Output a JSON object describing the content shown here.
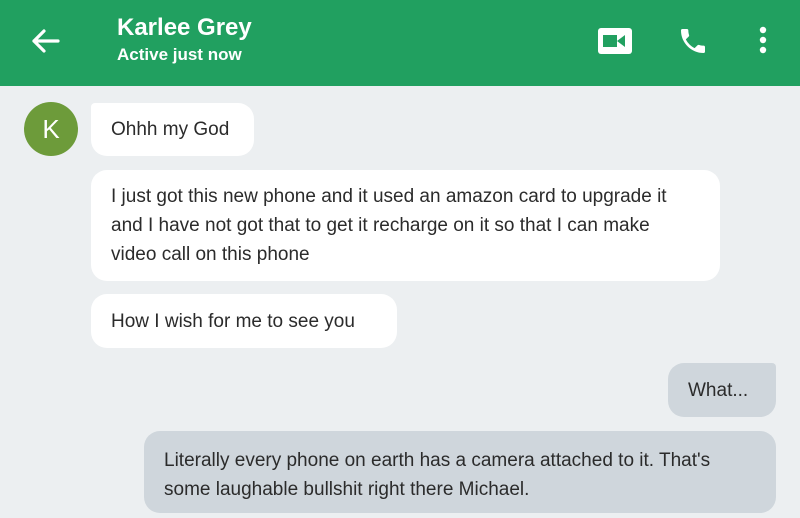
{
  "header": {
    "contact_name": "Karlee Grey",
    "status": "Active just now",
    "background_color": "#21a060",
    "icons": {
      "back": "arrow-left-icon",
      "video": "video-camera-icon",
      "call": "phone-icon",
      "menu": "more-vert-icon"
    }
  },
  "contact": {
    "avatar_initial": "K",
    "avatar_color": "#6d9b3a"
  },
  "messages": [
    {
      "sender": "incoming",
      "text": "Ohhh my God"
    },
    {
      "sender": "incoming",
      "text": "I just got this new phone and it used an amazon card to upgrade it and I have not got that to get it recharge on it so that I can make video call on this phone"
    },
    {
      "sender": "incoming",
      "text": "How I wish for me to see you"
    },
    {
      "sender": "outgoing",
      "text": "What..."
    },
    {
      "sender": "outgoing",
      "text": "Literally every phone on earth has a camera attached to it. That's some laughable bullshit right there Michael."
    }
  ],
  "colors": {
    "background": "#eceff1",
    "incoming_bubble": "#ffffff",
    "outgoing_bubble": "#cfd6dc"
  }
}
